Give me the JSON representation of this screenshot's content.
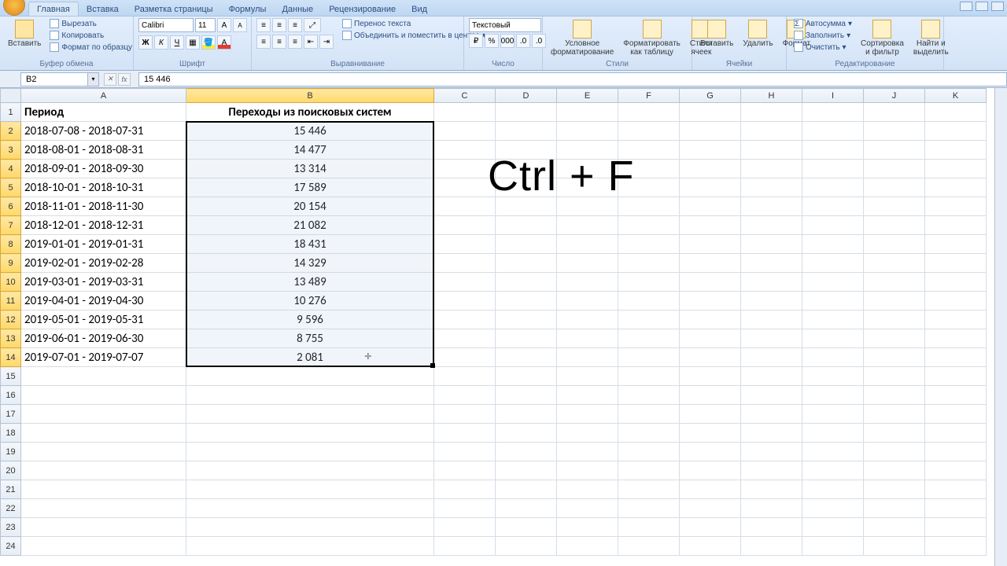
{
  "tabs": {
    "home": "Главная",
    "insert": "Вставка",
    "page_layout": "Разметка страницы",
    "formulas": "Формулы",
    "data": "Данные",
    "review": "Рецензирование",
    "view": "Вид"
  },
  "ribbon": {
    "clipboard": {
      "paste": "Вставить",
      "cut": "Вырезать",
      "copy": "Копировать",
      "format_painter": "Формат по образцу",
      "title": "Буфер обмена"
    },
    "font": {
      "family": "Calibri",
      "size": "11",
      "title": "Шрифт"
    },
    "alignment": {
      "wrap": "Перенос текста",
      "merge": "Объединить и поместить в центре",
      "title": "Выравнивание"
    },
    "number": {
      "format": "Текстовый",
      "title": "Число"
    },
    "styles": {
      "cond_format": "Условное\nформатирование",
      "as_table": "Форматировать\nкак таблицу",
      "cell_styles": "Стили\nячеек",
      "title": "Стили"
    },
    "cells": {
      "insert": "Вставить",
      "delete": "Удалить",
      "format": "Формат",
      "title": "Ячейки"
    },
    "editing": {
      "autosum": "Автосумма",
      "fill": "Заполнить",
      "clear": "Очистить",
      "sort": "Сортировка\nи фильтр",
      "find": "Найти и\nвыделить",
      "title": "Редактирование"
    }
  },
  "name_box": "B2",
  "formula_value": "15 446",
  "columns": [
    "A",
    "B",
    "C",
    "D",
    "E",
    "F",
    "G",
    "H",
    "I",
    "J",
    "K"
  ],
  "header_row": {
    "A": "Период",
    "B": "Переходы из поисковых систем"
  },
  "data_rows": [
    {
      "A": "2018-07-08 - 2018-07-31",
      "B": "15 446"
    },
    {
      "A": "2018-08-01 - 2018-08-31",
      "B": "14 477"
    },
    {
      "A": "2018-09-01 - 2018-09-30",
      "B": "13 314"
    },
    {
      "A": "2018-10-01 - 2018-10-31",
      "B": "17 589"
    },
    {
      "A": "2018-11-01 - 2018-11-30",
      "B": "20 154"
    },
    {
      "A": "2018-12-01 - 2018-12-31",
      "B": "21 082"
    },
    {
      "A": "2019-01-01 - 2019-01-31",
      "B": "18 431"
    },
    {
      "A": "2019-02-01 - 2019-02-28",
      "B": "14 329"
    },
    {
      "A": "2019-03-01 - 2019-03-31",
      "B": "13 489"
    },
    {
      "A": "2019-04-01 - 2019-04-30",
      "B": "10 276"
    },
    {
      "A": "2019-05-01 - 2019-05-31",
      "B": "9 596"
    },
    {
      "A": "2019-06-01 - 2019-06-30",
      "B": "8 755"
    },
    {
      "A": "2019-07-01 - 2019-07-07",
      "B": "2 081"
    }
  ],
  "total_rows": 24,
  "annotation": "Ctrl + F"
}
